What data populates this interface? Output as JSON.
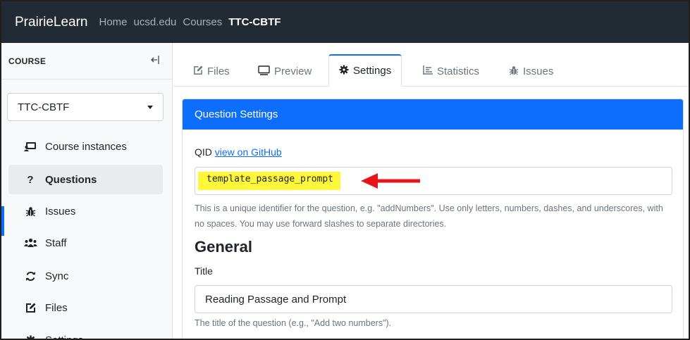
{
  "navbar": {
    "brand": "PrairieLearn",
    "breadcrumbs": [
      "Home",
      "ucsd.edu",
      "Courses",
      "TTC-CBTF"
    ]
  },
  "sidebar": {
    "header": "COURSE",
    "course_select": "TTC-CBTF",
    "items": [
      {
        "label": "Course instances",
        "icon": "course-instances-icon"
      },
      {
        "label": "Questions",
        "icon": "question-mark-icon"
      },
      {
        "label": "Issues",
        "icon": "bug-icon"
      },
      {
        "label": "Staff",
        "icon": "users-icon"
      },
      {
        "label": "Sync",
        "icon": "sync-icon"
      },
      {
        "label": "Files",
        "icon": "edit-icon"
      },
      {
        "label": "Settings",
        "icon": "gear-icon"
      }
    ]
  },
  "tabs": [
    {
      "label": "Files",
      "icon": "edit-icon"
    },
    {
      "label": "Preview",
      "icon": "monitor-icon"
    },
    {
      "label": "Settings",
      "icon": "gear-icon"
    },
    {
      "label": "Statistics",
      "icon": "bar-chart-icon"
    },
    {
      "label": "Issues",
      "icon": "bug-icon"
    }
  ],
  "card": {
    "header": "Question Settings",
    "qid_label": "QID",
    "qid_link": "view on GitHub",
    "qid_value": "template_passage_prompt",
    "qid_help": "This is a unique identifier for the question, e.g. \"addNumbers\". Use only letters, numbers, dashes, and underscores, with no spaces. You may use forward slashes to separate directories.",
    "section_heading": "General",
    "title_label": "Title",
    "title_value": "Reading Passage and Prompt",
    "title_help": "The title of the question (e.g., \"Add two numbers\")."
  },
  "colors": {
    "navbar_bg": "#222b33",
    "primary": "#0d6efd",
    "highlight": "#fff73a",
    "annotation_arrow": "#e8141c"
  }
}
